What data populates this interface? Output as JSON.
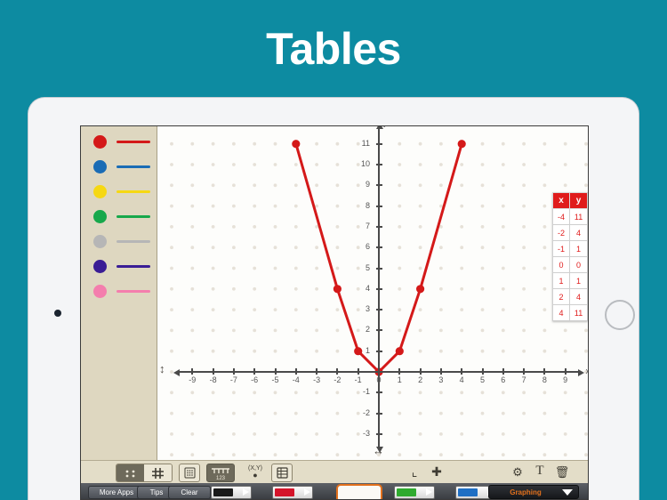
{
  "banner": {
    "title": "Tables"
  },
  "app": {
    "palette": [
      {
        "name": "red",
        "color": "#d41919"
      },
      {
        "name": "blue",
        "color": "#1a6cb5"
      },
      {
        "name": "yellow",
        "color": "#f6d813"
      },
      {
        "name": "green",
        "color": "#17a84b"
      },
      {
        "name": "gray",
        "color": "#b6b6b6"
      },
      {
        "name": "purple",
        "color": "#3a1d95"
      },
      {
        "name": "pink",
        "color": "#f47ead"
      }
    ],
    "toolbar": {
      "view_toggle": [
        {
          "icon": "dots-grid-icon",
          "selected": true
        },
        {
          "icon": "square-grid-icon",
          "selected": false
        }
      ],
      "buttons": [
        {
          "icon": "dot-paper-icon",
          "label": "",
          "selected": false
        },
        {
          "icon": "number-line-icon",
          "label": "123",
          "selected": true
        },
        {
          "icon": "coordinate-point-icon",
          "label": "(X,Y)",
          "selected": false
        },
        {
          "icon": "table-icon",
          "label": "",
          "selected": false
        }
      ],
      "right_buttons": [
        {
          "icon": "axes-icon",
          "glyph": "└"
        },
        {
          "icon": "move-icon",
          "glyph": "✛"
        },
        {
          "icon": "gear-icon",
          "glyph": "⚙"
        },
        {
          "icon": "text-icon",
          "glyph": "T"
        },
        {
          "icon": "trash-icon",
          "glyph": "Ὕ1"
        }
      ]
    },
    "device_bar": {
      "buttons": [
        {
          "label": "More Apps"
        },
        {
          "label": "Tips"
        },
        {
          "label": "Clear"
        }
      ],
      "pens": [
        {
          "name": "black-pen",
          "color": "#1a1a1a",
          "selected": false
        },
        {
          "name": "red-pen",
          "color": "#d4142a",
          "selected": false
        },
        {
          "name": "eraser",
          "color": "#ffffff",
          "selected": true
        },
        {
          "name": "green-pen",
          "color": "#2faa2f",
          "selected": false
        },
        {
          "name": "blue-pen",
          "color": "#1f6fc4",
          "selected": false
        }
      ],
      "mode": {
        "label": "Graphing",
        "caret": "▼"
      }
    }
  },
  "chart_data": {
    "type": "line",
    "title": "",
    "xlabel": "x",
    "ylabel": "y",
    "xlim": [
      -9.5,
      9.5
    ],
    "ylim": [
      -3.5,
      11.5
    ],
    "xticks": [
      -9,
      -8,
      -7,
      -6,
      -5,
      -4,
      -3,
      -2,
      -1,
      0,
      1,
      2,
      3,
      4,
      5,
      6,
      7,
      8,
      9
    ],
    "yticks": [
      -3,
      -2,
      -1,
      0,
      1,
      2,
      3,
      4,
      5,
      6,
      7,
      8,
      9,
      10,
      11
    ],
    "grid": "dots",
    "series": [
      {
        "name": "red",
        "color": "#d41919",
        "x": [
          -4,
          -2,
          -1,
          0,
          1,
          2,
          4
        ],
        "y": [
          11,
          4,
          1,
          0,
          1,
          4,
          11
        ],
        "marker": "circle"
      }
    ],
    "table": {
      "headers": [
        "x",
        "y"
      ],
      "rows": [
        [
          "-4",
          "11"
        ],
        [
          "-2",
          "4"
        ],
        [
          "-1",
          "1"
        ],
        [
          "0",
          "0"
        ],
        [
          "1",
          "1"
        ],
        [
          "2",
          "4"
        ],
        [
          "4",
          "11"
        ]
      ],
      "header_color": "#e01b1b",
      "text_color": "#e01b1b"
    }
  }
}
